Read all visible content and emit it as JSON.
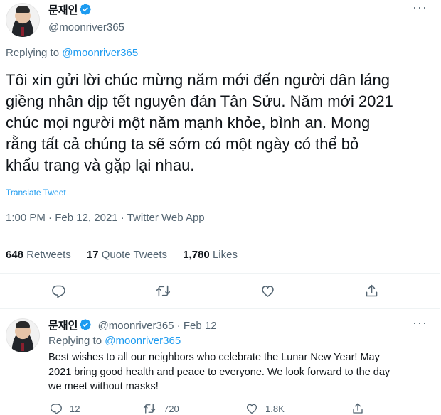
{
  "main_tweet": {
    "display_name": "문재인",
    "handle": "@moonriver365",
    "more_label": "···",
    "replying_prefix": "Replying to",
    "replying_handle": "@moonriver365",
    "text_lines": [
      "Tôi xin gửi lời chúc mừng năm mới đến người dân láng",
      "giềng nhân dịp tết nguyên đán Tân Sửu. Năm mới 2021",
      "chúc mọi người một năm mạnh khỏe, bình an. Mong",
      "rằng tất cả chúng ta sẽ sớm có một ngày có thể bỏ",
      "khẩu trang và gặp lại nhau."
    ],
    "translate_label": "Translate Tweet",
    "time": "1:00 PM",
    "date": "Feb 12, 2021",
    "source": "Twitter Web App",
    "separator": "·",
    "stats": {
      "retweets_count": "648",
      "retweets_label": "Retweets",
      "quote_count": "17",
      "quote_label": "Quote Tweets",
      "likes_count": "1,780",
      "likes_label": "Likes"
    }
  },
  "reply_tweet": {
    "display_name": "문재인",
    "handle": "@moonriver365",
    "separator": "·",
    "date": "Feb 12",
    "more_label": "···",
    "replying_prefix": "Replying to",
    "replying_handle": "@moonriver365",
    "text_lines": [
      "Best wishes to all our neighbors who celebrate the Lunar New Year! May",
      "2021 bring good health and peace to everyone. We look forward to the day",
      "we meet without masks!"
    ],
    "reply_count": "12",
    "retweet_count": "720",
    "like_count": "1.8K"
  },
  "colors": {
    "accent": "#1d9bf0",
    "text": "#0f1419",
    "muted": "#536471",
    "divider": "#eff3f4"
  },
  "icons": [
    "verified-badge-icon",
    "reply-icon",
    "retweet-icon",
    "like-icon",
    "share-icon",
    "more-icon"
  ]
}
